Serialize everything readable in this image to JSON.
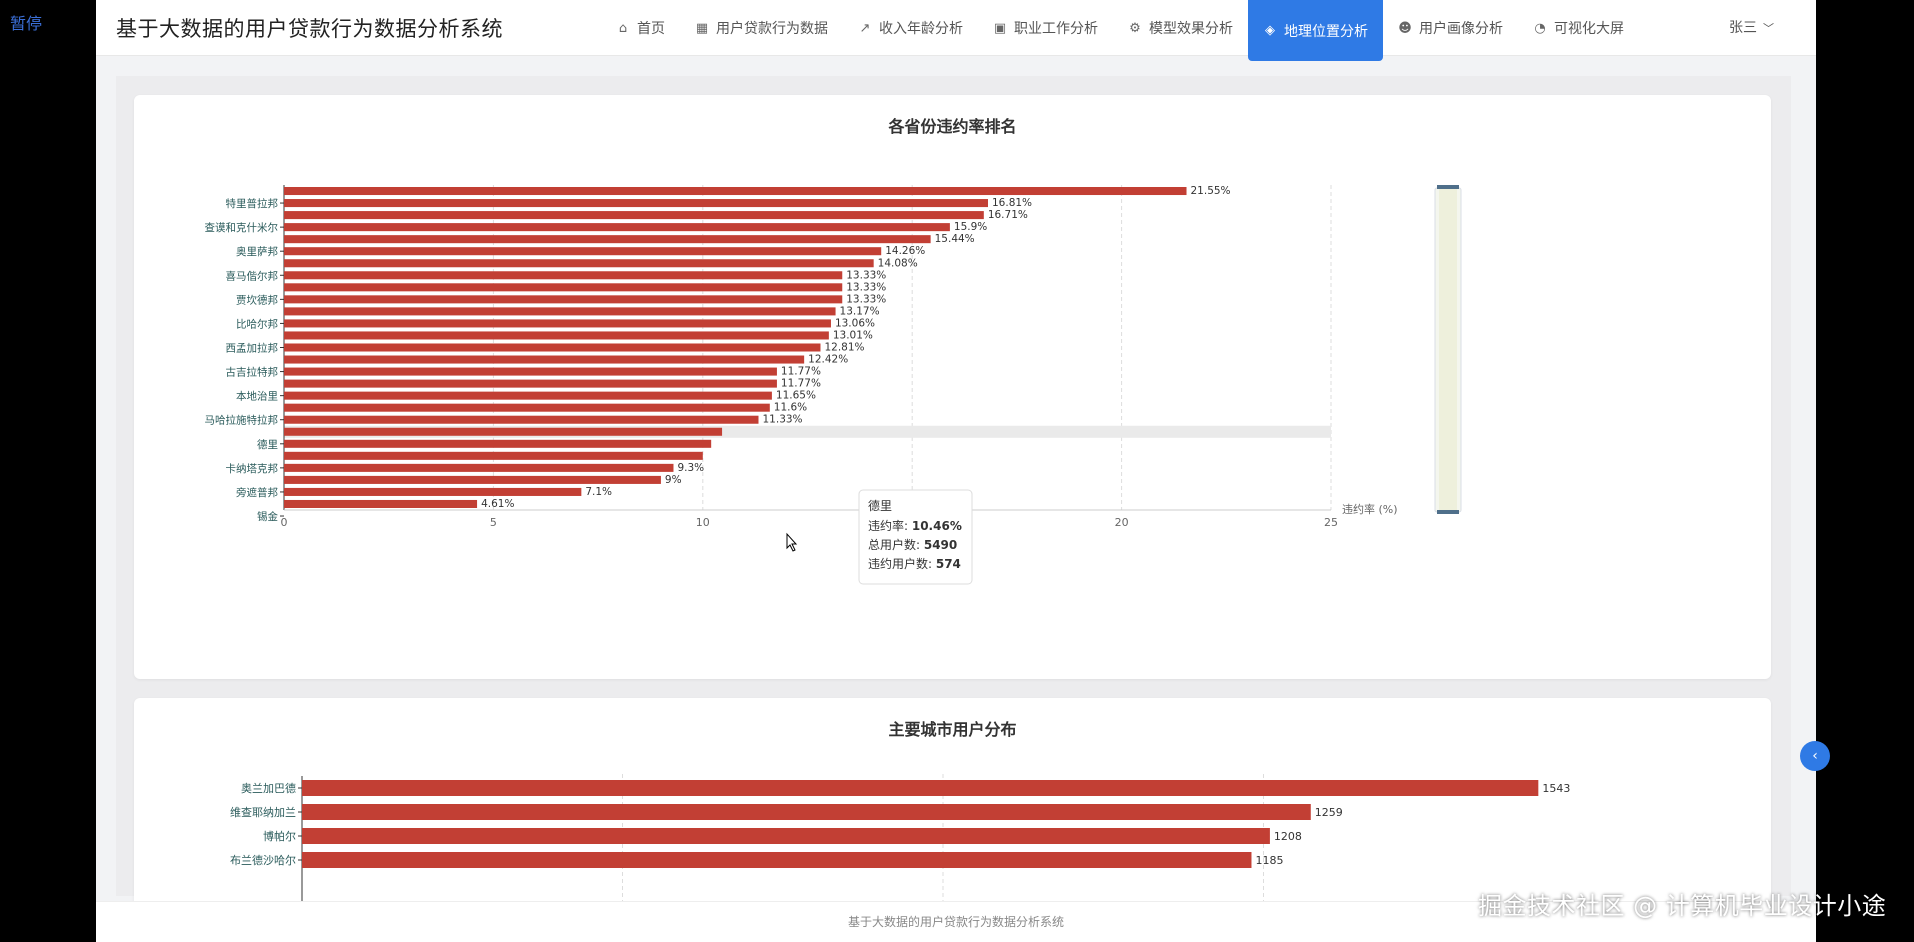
{
  "overlay": {
    "pause_label": "暂停",
    "watermark": "掘金技术社区 @ 计算机毕业设计小途"
  },
  "header": {
    "title": "基于大数据的用户贷款行为数据分析系统",
    "nav": [
      {
        "label": "首页",
        "icon": "home-icon",
        "glyph": "⌂",
        "active": false
      },
      {
        "label": "用户贷款行为数据",
        "icon": "table-icon",
        "glyph": "▦",
        "active": false
      },
      {
        "label": "收入年龄分析",
        "icon": "line-chart-icon",
        "glyph": "↗",
        "active": false
      },
      {
        "label": "职业工作分析",
        "icon": "briefcase-icon",
        "glyph": "▣",
        "active": false
      },
      {
        "label": "模型效果分析",
        "icon": "gears-icon",
        "glyph": "⚙",
        "active": false
      },
      {
        "label": "地理位置分析",
        "icon": "map-icon",
        "glyph": "◈",
        "active": true
      },
      {
        "label": "用户画像分析",
        "icon": "users-icon",
        "glyph": "☻",
        "active": false
      },
      {
        "label": "可视化大屏",
        "icon": "pie-icon",
        "glyph": "◔",
        "active": false
      }
    ],
    "user": "张三"
  },
  "footer": {
    "text": "基于大数据的用户贷款行为数据分析系统"
  },
  "colors": {
    "bar": "#c23f34",
    "accent": "#2f7ae5"
  },
  "chart_data": [
    {
      "type": "bar",
      "orientation": "horizontal",
      "title": "各省份违约率排名",
      "xlabel": "违约率 (%)",
      "xlim": [
        0,
        25
      ],
      "xticks": [
        0,
        5,
        10,
        15,
        20,
        25
      ],
      "label_suffix": "%",
      "categories": [
        "特里普拉邦",
        "查谟和克什米尔",
        "奥里萨邦",
        "喜马偕尔邦",
        "贾坎德邦",
        "比哈尔邦",
        "西孟加拉邦",
        "古吉拉特邦",
        "本地治里",
        "马哈拉施特拉邦",
        "德里",
        "卡纳塔克邦",
        "旁遮普邦",
        "锡金"
      ],
      "values": [
        21.55,
        16.81,
        16.71,
        15.9,
        15.44,
        14.26,
        14.08,
        13.33,
        13.33,
        13.33,
        13.17,
        13.06,
        13.01,
        12.81,
        12.42,
        11.77,
        11.77,
        11.65,
        11.6,
        11.33,
        10.46,
        10.2,
        10.0,
        9.3,
        9,
        7.1,
        4.61
      ],
      "visible_bar_labels": [
        "21.55%",
        "16.81%",
        "16.71%",
        "15.9%",
        "15.44%",
        "14.26%",
        "14.08%",
        "13.33%",
        "13.33%",
        "13.33%",
        "13.17%",
        "13.06%",
        "13.01%",
        "12.81%",
        "12.42%",
        "11.77%",
        "11.77%",
        "11.65%",
        "11.6%",
        "11.33%",
        "",
        "",
        "",
        "9.3%",
        "9%",
        "7.1%",
        "4.61%"
      ],
      "highlighted_index": 20,
      "tooltip": {
        "name": "德里",
        "rows": [
          {
            "label": "违约率:",
            "value": "10.46%"
          },
          {
            "label": "总用户数:",
            "value": "5490"
          },
          {
            "label": "违约用户数:",
            "value": "574"
          }
        ]
      },
      "grid": true,
      "data_zoom": "vertical slider, right"
    },
    {
      "type": "bar",
      "orientation": "horizontal",
      "title": "主要城市用户分布",
      "xlim": [
        0,
        1600
      ],
      "categories": [
        "奥兰加巴德",
        "维查耶纳加兰",
        "博帕尔",
        "布兰德沙哈尔"
      ],
      "values": [
        1543,
        1259,
        1208,
        1185
      ],
      "grid": true
    }
  ]
}
